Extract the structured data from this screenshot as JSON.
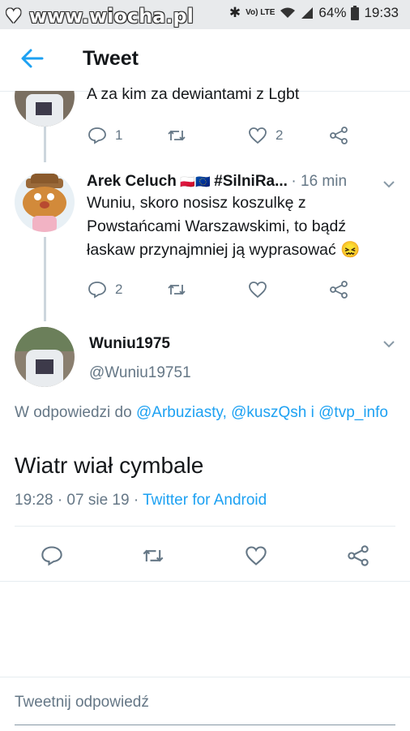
{
  "status_bar": {
    "watermark": "www.wiocha.pl",
    "lte_label": "Vo) LTE",
    "battery_percent": "64%",
    "time": "19:33"
  },
  "app_bar": {
    "title": "Tweet"
  },
  "tweets": [
    {
      "text": "A za  kim za dewiantami z Lgbt",
      "reply_count": "1",
      "like_count": "2"
    },
    {
      "name": "Arek Celuch",
      "flags": "🇵🇱🇪🇺",
      "hashtag": "#SilniRa...",
      "time": "· 16 min",
      "text": "Wuniu, skoro nosisz koszulkę z Powstańcami Warszawskimi, to bądź łaskaw przynajmniej ją wyprasować 😖",
      "reply_count": "2",
      "like_count": ""
    }
  ],
  "main_tweet": {
    "name": "Wuniu1975",
    "handle": "@Wuniu19751",
    "reply_prefix": "W odpowiedzi do",
    "reply_to_1": "@Arbuziasty,",
    "reply_to_2": "@kuszQsh",
    "reply_and": "i",
    "reply_to_3": "@tvp_info",
    "text": "Wiatr wiał cymbale",
    "timestamp": "19:28 · 07 sie 19 ·",
    "source": "Twitter for Android"
  },
  "reply_bar": {
    "placeholder": "Tweetnij odpowiedź"
  },
  "colors": {
    "accent": "#1da1f2",
    "secondary_text": "#657786",
    "divider": "#e6ecf0"
  }
}
